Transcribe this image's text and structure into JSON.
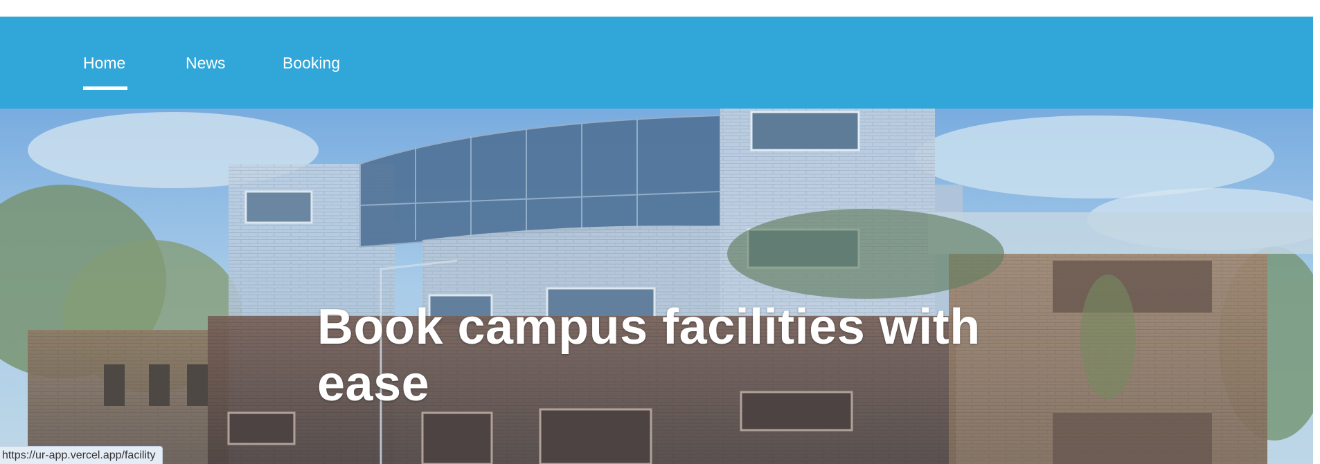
{
  "nav": {
    "items": [
      {
        "label": "Home",
        "active": true
      },
      {
        "label": "News",
        "active": false
      },
      {
        "label": "Booking",
        "active": false
      }
    ]
  },
  "hero": {
    "title_line1": "Book campus facilities with",
    "title_line2": "ease"
  },
  "status_bar": {
    "url": "https://ur-app.vercel.app/facility"
  },
  "colors": {
    "nav_background": "#31a6d8",
    "nav_text": "#ffffff",
    "hero_title": "#ffffff"
  }
}
